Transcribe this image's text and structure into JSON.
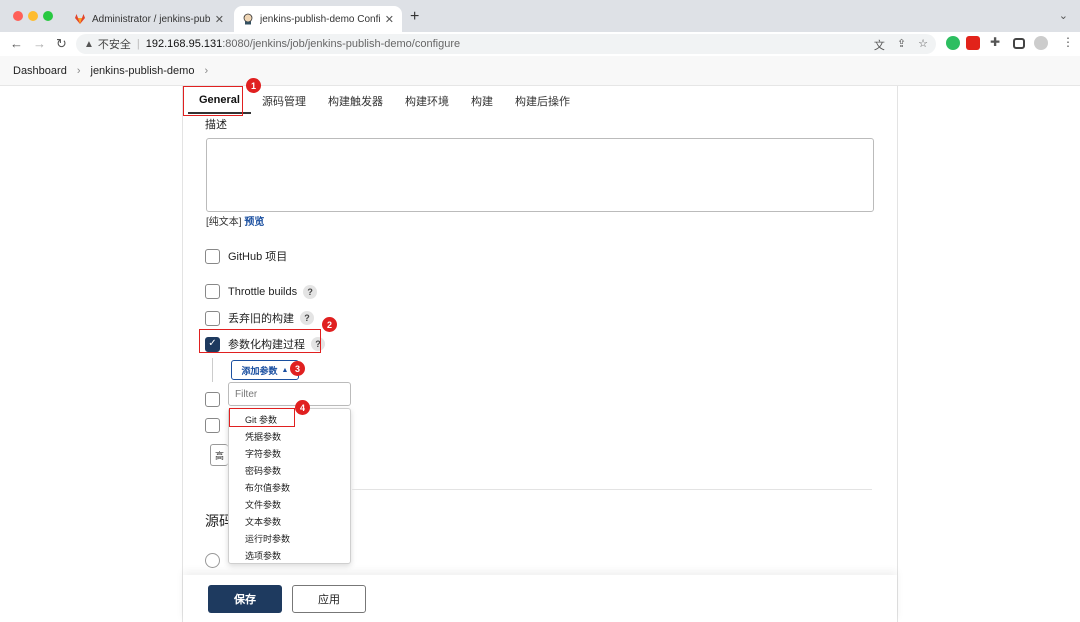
{
  "browser": {
    "tabs": [
      {
        "title": "Administrator / jenkins-publish",
        "icon": "gitlab-icon"
      },
      {
        "title": "jenkins-publish-demo Config [",
        "icon": "jenkins-icon"
      }
    ],
    "insecure_label": "不安全",
    "url_host": "192.168.95.131",
    "url_path": ":8080/jenkins/job/jenkins-publish-demo/configure"
  },
  "breadcrumbs": {
    "items": [
      "Dashboard",
      "jenkins-publish-demo"
    ]
  },
  "config_tabs": [
    "General",
    "源码管理",
    "构建触发器",
    "构建环境",
    "构建",
    "构建后操作"
  ],
  "general": {
    "description_label": "描述",
    "plain_text_label": "[纯文本]",
    "preview_link": "预览",
    "options": [
      {
        "label": "GitHub 项目",
        "checked": false,
        "help": false
      },
      {
        "label": "Throttle builds",
        "checked": false,
        "help": true
      },
      {
        "label": "丢弃旧的构建",
        "checked": false,
        "help": true
      },
      {
        "label": "参数化构建过程",
        "checked": true,
        "help": true
      }
    ],
    "add_param_label": "添加参数",
    "filter_placeholder": "Filter",
    "param_types": [
      "Git 参数",
      "凭据参数",
      "字符参数",
      "密码参数",
      "布尔值参数",
      "文件参数",
      "文本参数",
      "运行时参数",
      "选项参数"
    ],
    "advanced_partial": "高",
    "section_heading_partial": "源码管理"
  },
  "footer": {
    "save_label": "保存",
    "apply_label": "应用"
  },
  "help_glyph": "?",
  "annotations": [
    "1",
    "2",
    "3",
    "4"
  ],
  "colors": {
    "primary": "#1e3a5f",
    "link": "#1a4fa0",
    "annotation": "#e02020"
  }
}
